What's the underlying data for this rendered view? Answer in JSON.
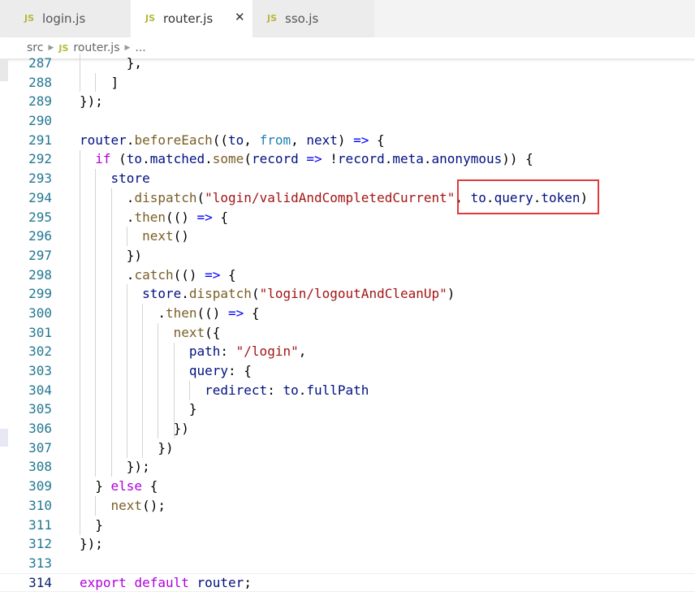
{
  "tabs": [
    {
      "label": "login.js",
      "badge": "JS"
    },
    {
      "label": "router.js",
      "badge": "JS",
      "close": "✕"
    },
    {
      "label": "sso.js",
      "badge": "JS"
    }
  ],
  "breadcrumb": {
    "root": "src",
    "badge": "JS",
    "file": "router.js",
    "more": "..."
  },
  "highlight": {
    "text": "to.query.token)",
    "color": "#e03a3a"
  },
  "code_lines": [
    {
      "n": "287",
      "tokens": [
        [
          "p",
          "      },"
        ]
      ]
    },
    {
      "n": "288",
      "tokens": [
        [
          "p",
          "    ]"
        ]
      ]
    },
    {
      "n": "289",
      "tokens": [
        [
          "p",
          "});"
        ]
      ]
    },
    {
      "n": "290",
      "tokens": []
    },
    {
      "n": "291",
      "tokens": [
        [
          "vr",
          "router"
        ],
        [
          "p",
          "."
        ],
        [
          "fn",
          "beforeEach"
        ],
        [
          "p",
          "(("
        ],
        [
          "vr",
          "to"
        ],
        [
          "p",
          ", "
        ],
        [
          "fr",
          "from"
        ],
        [
          "p",
          ", "
        ],
        [
          "vr",
          "next"
        ],
        [
          "p",
          ") "
        ],
        [
          "bl",
          "=>"
        ],
        [
          "p",
          " {"
        ]
      ]
    },
    {
      "n": "292",
      "tokens": [
        [
          "p",
          "  "
        ],
        [
          "kw",
          "if"
        ],
        [
          "p",
          " ("
        ],
        [
          "vr",
          "to"
        ],
        [
          "p",
          "."
        ],
        [
          "vr",
          "matched"
        ],
        [
          "p",
          "."
        ],
        [
          "fn",
          "some"
        ],
        [
          "p",
          "("
        ],
        [
          "vr",
          "record"
        ],
        [
          "p",
          " "
        ],
        [
          "bl",
          "=>"
        ],
        [
          "p",
          " !"
        ],
        [
          "vr",
          "record"
        ],
        [
          "p",
          "."
        ],
        [
          "vr",
          "meta"
        ],
        [
          "p",
          "."
        ],
        [
          "vr",
          "anonymous"
        ],
        [
          "p",
          ")) {"
        ]
      ]
    },
    {
      "n": "293",
      "tokens": [
        [
          "p",
          "    "
        ],
        [
          "vr",
          "store"
        ]
      ]
    },
    {
      "n": "294",
      "tokens": [
        [
          "p",
          "      ."
        ],
        [
          "fn",
          "dispatch"
        ],
        [
          "p",
          "("
        ],
        [
          "st",
          "\"login/validAndCompletedCurrent\""
        ],
        [
          "p",
          ", "
        ],
        [
          "vr",
          "to"
        ],
        [
          "p",
          "."
        ],
        [
          "vr",
          "query"
        ],
        [
          "p",
          "."
        ],
        [
          "vr",
          "token"
        ],
        [
          "p",
          ")"
        ]
      ]
    },
    {
      "n": "295",
      "tokens": [
        [
          "p",
          "      ."
        ],
        [
          "fn",
          "then"
        ],
        [
          "p",
          "(() "
        ],
        [
          "bl",
          "=>"
        ],
        [
          "p",
          " {"
        ]
      ]
    },
    {
      "n": "296",
      "tokens": [
        [
          "p",
          "        "
        ],
        [
          "fn",
          "next"
        ],
        [
          "p",
          "()"
        ]
      ]
    },
    {
      "n": "297",
      "tokens": [
        [
          "p",
          "      })"
        ]
      ]
    },
    {
      "n": "298",
      "tokens": [
        [
          "p",
          "      ."
        ],
        [
          "fn",
          "catch"
        ],
        [
          "p",
          "(() "
        ],
        [
          "bl",
          "=>"
        ],
        [
          "p",
          " {"
        ]
      ]
    },
    {
      "n": "299",
      "tokens": [
        [
          "p",
          "        "
        ],
        [
          "vr",
          "store"
        ],
        [
          "p",
          "."
        ],
        [
          "fn",
          "dispatch"
        ],
        [
          "p",
          "("
        ],
        [
          "st",
          "\"login/logoutAndCleanUp\""
        ],
        [
          "p",
          ")"
        ]
      ]
    },
    {
      "n": "300",
      "tokens": [
        [
          "p",
          "          ."
        ],
        [
          "fn",
          "then"
        ],
        [
          "p",
          "(() "
        ],
        [
          "bl",
          "=>"
        ],
        [
          "p",
          " {"
        ]
      ]
    },
    {
      "n": "301",
      "tokens": [
        [
          "p",
          "            "
        ],
        [
          "fn",
          "next"
        ],
        [
          "p",
          "({"
        ]
      ]
    },
    {
      "n": "302",
      "tokens": [
        [
          "p",
          "              "
        ],
        [
          "vr",
          "path"
        ],
        [
          "p",
          ": "
        ],
        [
          "st",
          "\"/login\""
        ],
        [
          "p",
          ","
        ]
      ]
    },
    {
      "n": "303",
      "tokens": [
        [
          "p",
          "              "
        ],
        [
          "vr",
          "query"
        ],
        [
          "p",
          ": {"
        ]
      ]
    },
    {
      "n": "304",
      "tokens": [
        [
          "p",
          "                "
        ],
        [
          "vr",
          "redirect"
        ],
        [
          "p",
          ": "
        ],
        [
          "vr",
          "to"
        ],
        [
          "p",
          "."
        ],
        [
          "vr",
          "fullPath"
        ]
      ]
    },
    {
      "n": "305",
      "tokens": [
        [
          "p",
          "              }"
        ]
      ]
    },
    {
      "n": "306",
      "tokens": [
        [
          "p",
          "            })"
        ]
      ]
    },
    {
      "n": "307",
      "tokens": [
        [
          "p",
          "          })"
        ]
      ]
    },
    {
      "n": "308",
      "tokens": [
        [
          "p",
          "      });"
        ]
      ]
    },
    {
      "n": "309",
      "tokens": [
        [
          "p",
          "  } "
        ],
        [
          "kw",
          "else"
        ],
        [
          "p",
          " {"
        ]
      ]
    },
    {
      "n": "310",
      "tokens": [
        [
          "p",
          "    "
        ],
        [
          "fn",
          "next"
        ],
        [
          "p",
          "();"
        ]
      ]
    },
    {
      "n": "311",
      "tokens": [
        [
          "p",
          "  }"
        ]
      ]
    },
    {
      "n": "312",
      "tokens": [
        [
          "p",
          "});"
        ]
      ]
    },
    {
      "n": "313",
      "tokens": []
    },
    {
      "n": "314",
      "tokens": [
        [
          "kw",
          "export"
        ],
        [
          "p",
          " "
        ],
        [
          "kw",
          "default"
        ],
        [
          "p",
          " "
        ],
        [
          "vr",
          "router"
        ],
        [
          "p",
          ";"
        ]
      ]
    }
  ],
  "current_line": "314",
  "colors": {
    "keyword": "#af00db",
    "function": "#795e26",
    "string": "#a31515",
    "variable": "#001080",
    "arrow": "#0000ff",
    "line_number": "#237893",
    "highlight_border": "#e03a3a"
  }
}
